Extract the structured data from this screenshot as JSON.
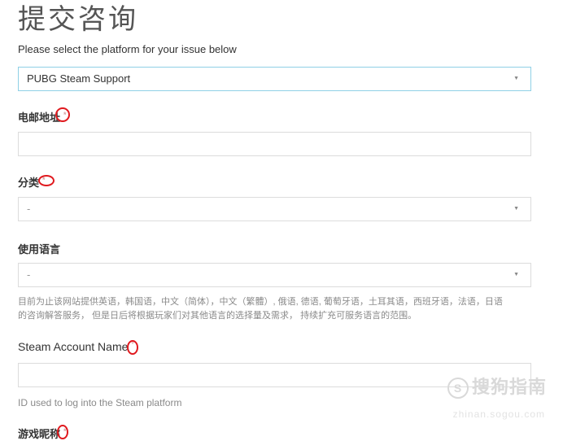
{
  "page": {
    "title": "提交咨询"
  },
  "platform": {
    "label": "Please select the platform for your issue below",
    "selected": "PUBG Steam Support"
  },
  "email": {
    "label": "电邮地址",
    "required_mark": "*"
  },
  "category": {
    "label": "分类",
    "required_mark": "*",
    "selected": "-"
  },
  "language": {
    "label": "使用语言",
    "selected": "-",
    "help_line1": "目前为止该网站提供英语，韩国语，中文（简体），中文（繁體）, 俄语, 德语, 葡萄牙语，土耳其语，西班牙语，法语，日语",
    "help_line2": "的咨询解答服务， 但是日后将根据玩家们对其他语言的选择量及需求， 持续扩充可服务语言的范围。"
  },
  "steam_account": {
    "label": "Steam Account Name",
    "required_mark": "*",
    "help": "ID used to log into the Steam platform"
  },
  "nickname": {
    "label": "游戏昵称",
    "required_mark": "*"
  },
  "watermark": {
    "text": "搜狗指南",
    "url": "zhinan.sogou.com",
    "logo_glyph": "S"
  },
  "colors": {
    "annotation_red": "#e0191e",
    "active_border": "#8fd0e6"
  }
}
